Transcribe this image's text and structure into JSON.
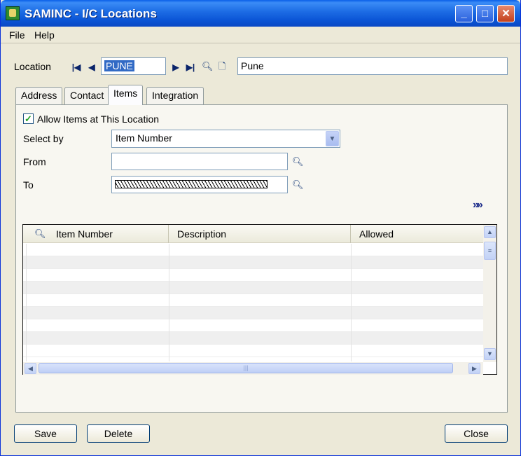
{
  "window": {
    "title": "SAMINC - I/C Locations"
  },
  "menu": {
    "file": "File",
    "help": "Help"
  },
  "location": {
    "label": "Location",
    "code": "PUNE",
    "description": "Pune"
  },
  "tabs": [
    {
      "label": "Address"
    },
    {
      "label": "Contact"
    },
    {
      "label": "Items"
    },
    {
      "label": "Integration"
    }
  ],
  "items": {
    "allow_label": "Allow Items at This Location",
    "allow_checked": true,
    "select_by_label": "Select by",
    "select_by_value": "Item Number",
    "from_label": "From",
    "from_value": "",
    "to_label": "To"
  },
  "grid": {
    "columns": [
      "Item Number",
      "Description",
      "Allowed"
    ],
    "rows": []
  },
  "buttons": {
    "save": "Save",
    "delete": "Delete",
    "close": "Close"
  },
  "icons": {
    "title": "app-icon",
    "first": "first-record-icon",
    "prev": "previous-record-icon",
    "next": "next-record-icon",
    "last": "last-record-icon",
    "finder": "search-icon",
    "new": "new-document-icon",
    "expand": "double-chevron-right-icon"
  }
}
